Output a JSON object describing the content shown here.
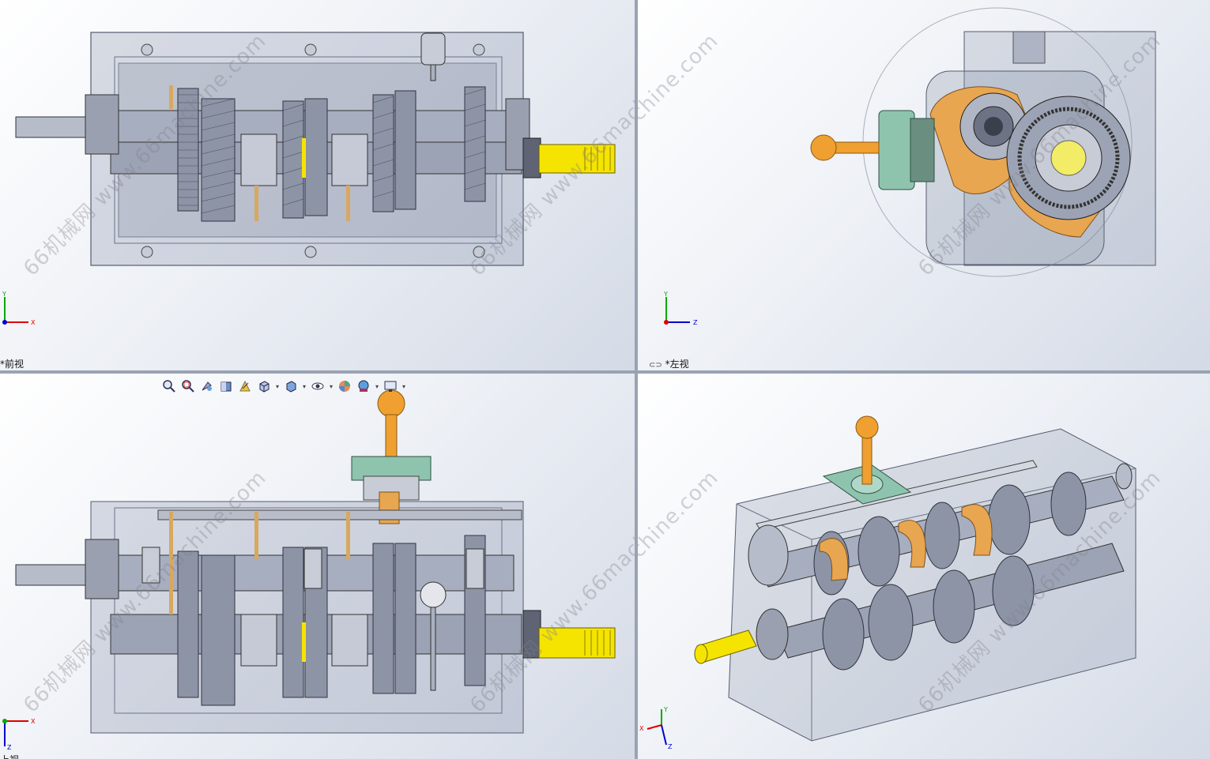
{
  "views": {
    "front": {
      "label": "*前视"
    },
    "left": {
      "label": "*左视"
    },
    "top": {
      "label": "上视"
    }
  },
  "watermark": {
    "text": "66机械网 www.66machine.com"
  },
  "axes": {
    "front": {
      "x": "X",
      "y": "Y"
    },
    "left": {
      "z": "Z",
      "y": "Y"
    },
    "top": {
      "x": "X",
      "z": "Z"
    },
    "iso": {
      "x": "X",
      "y": "Y",
      "z": "Z"
    }
  },
  "toolbar": {
    "items": [
      "zoom-to-fit",
      "zoom-to-area",
      "previous-view",
      "section-view",
      "dynamic-annotation",
      "view-orientation",
      "display-style",
      "hide-show-items",
      "edit-appearance",
      "apply-scene",
      "view-settings"
    ]
  },
  "colors": {
    "shaft_yellow": "#f5e400",
    "knob_orange": "#f0a030",
    "fork_orange": "#e8a650",
    "housing": "#8b93a8",
    "cover_green": "#8ec4ae"
  }
}
